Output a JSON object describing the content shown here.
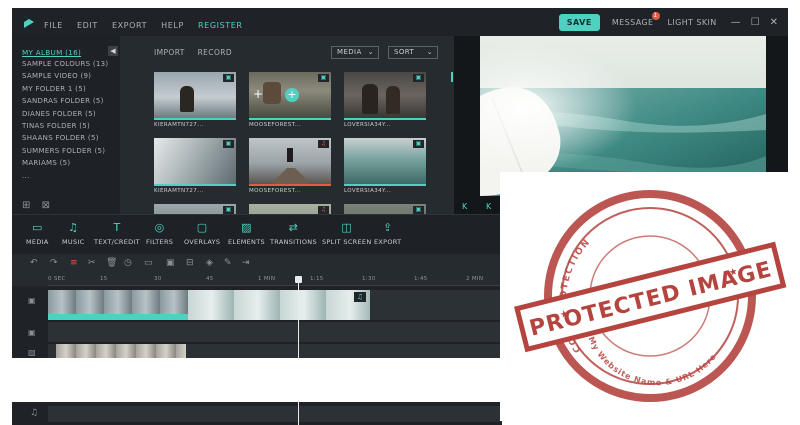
{
  "menu": [
    "FILE",
    "EDIT",
    "EXPORT",
    "HELP"
  ],
  "register": "REGISTER",
  "header": {
    "save": "SAVE",
    "messages": "MESSAGE",
    "message_count": "1",
    "skin": "LIGHT SKIN",
    "minimize": "—",
    "maximize": "☐",
    "close": "✕"
  },
  "sidebar": {
    "title": "MY ALBUM (16)",
    "folders": [
      "SAMPLE COLOURS (13)",
      "SAMPLE VIDEO (9)",
      "MY FOLDER 1 (5)",
      "SANDRAS FOLDER (5)",
      "DIANES FOLDER (5)",
      "TINAS FOLDER (5)",
      "SHAANS FOLDER (5)",
      "SUMMERS FOLDER (5)",
      "MARIAMS (5)",
      "..."
    ],
    "collapse_icon": "◀"
  },
  "library": {
    "tabs": [
      "IMPORT",
      "RECORD"
    ],
    "media_dropdown": "MEDIA",
    "sort_dropdown": "SORT",
    "clips": [
      {
        "name": "KIERAMTN727...",
        "kind": "video-icon",
        "bar_color": "#4fd1c1"
      },
      {
        "name": "MOOSEFOREST...",
        "kind": "video-icon",
        "bar_color": "#4fd1c1"
      },
      {
        "name": "LOVERSIA34Y...",
        "kind": "video-icon",
        "bar_color": "#4fd1c1"
      },
      {
        "name": "KIERAMTN727...",
        "kind": "video-icon",
        "bar_color": "#4fd1c1"
      },
      {
        "name": "MOOSEFOREST...",
        "kind": "audio-icon",
        "bar_color": "#e25b45"
      },
      {
        "name": "LOVERSIA34Y...",
        "kind": "video-icon",
        "bar_color": "#4fd1c1"
      },
      {
        "name": "",
        "kind": "video-icon",
        "bar_color": "#4fd1c1"
      },
      {
        "name": "",
        "kind": "audio-icon",
        "bar_color": "#e25b45"
      },
      {
        "name": "",
        "kind": "video-icon",
        "bar_color": "#4fd1c1"
      }
    ]
  },
  "preview": {
    "controls": [
      "K",
      "K"
    ]
  },
  "toolbar": {
    "items": [
      {
        "label": "MEDIA",
        "icon": "folder-icon"
      },
      {
        "label": "MUSIC",
        "icon": "music-note-icon"
      },
      {
        "label": "TEXT/CREDIT",
        "icon": "text-icon"
      },
      {
        "label": "FILTERS",
        "icon": "filters-icon"
      },
      {
        "label": "OVERLAYS",
        "icon": "overlays-icon"
      },
      {
        "label": "ELEMENTS",
        "icon": "elements-icon"
      },
      {
        "label": "TRANSITIONS",
        "icon": "transitions-icon"
      },
      {
        "label": "SPLIT SCREEN",
        "icon": "split-screen-icon"
      },
      {
        "label": "EXPORT",
        "icon": "export-icon"
      }
    ]
  },
  "timeline": {
    "ticks": [
      "0 SEC",
      "15",
      "30",
      "45",
      "1 MIN",
      "1:15",
      "1:30",
      "1:45",
      "2 MIN"
    ]
  },
  "stamp": {
    "main": "PROTECTED IMAGE",
    "ring_top": "COPY PROTECTION",
    "ring_bottom": "My Website Name & URL Here"
  },
  "colors": {
    "accent": "#4fd1c1",
    "audio": "#e25b45",
    "stamp": "#b5443f"
  }
}
